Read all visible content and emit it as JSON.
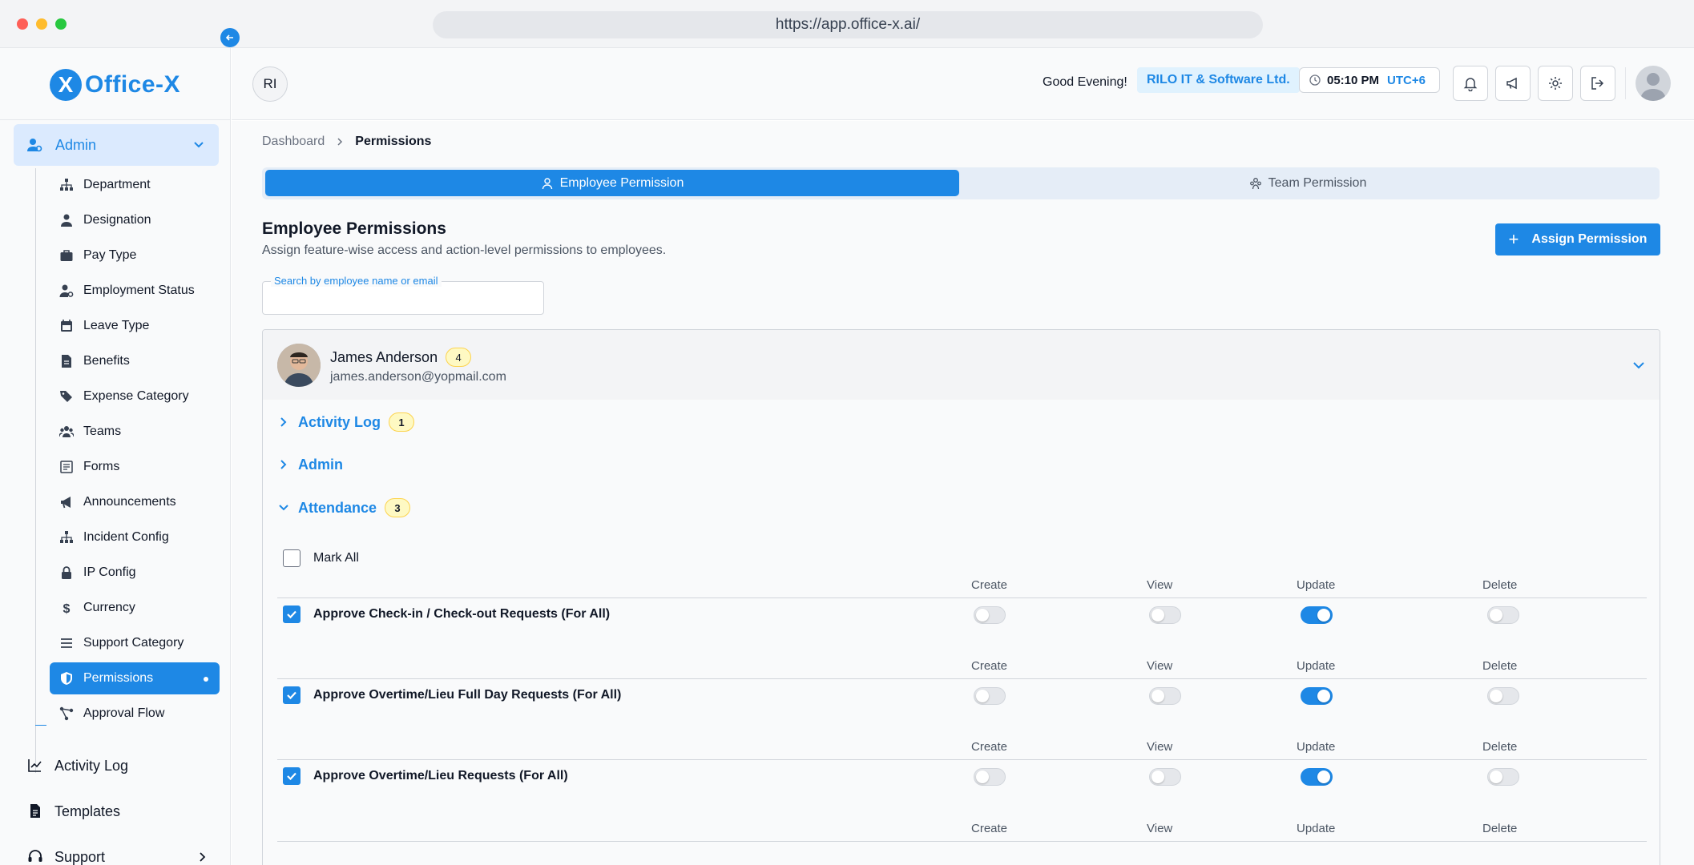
{
  "browser": {
    "url": "https://app.office-x.ai/"
  },
  "brand": {
    "logo_letter": "X",
    "name": "Office-X",
    "color": "#1e88e5"
  },
  "sidebar": {
    "admin_label": "Admin",
    "sub_items": [
      {
        "label": "Department",
        "icon": "sitemap-icon"
      },
      {
        "label": "Designation",
        "icon": "user-tie-icon"
      },
      {
        "label": "Pay Type",
        "icon": "briefcase-icon"
      },
      {
        "label": "Employment Status",
        "icon": "user-gear-icon"
      },
      {
        "label": "Leave Type",
        "icon": "calendar-icon"
      },
      {
        "label": "Benefits",
        "icon": "file-invoice-icon"
      },
      {
        "label": "Expense Category",
        "icon": "tags-icon"
      },
      {
        "label": "Teams",
        "icon": "users-icon"
      },
      {
        "label": "Forms",
        "icon": "form-icon"
      },
      {
        "label": "Announcements",
        "icon": "megaphone-icon"
      },
      {
        "label": "Incident Config",
        "icon": "sitemap-icon"
      },
      {
        "label": "IP Config",
        "icon": "lock-icon"
      },
      {
        "label": "Currency",
        "icon": "dollar-icon"
      },
      {
        "label": "Support Category",
        "icon": "list-icon"
      },
      {
        "label": "Permissions",
        "icon": "shield-icon",
        "active": true
      },
      {
        "label": "Approval Flow",
        "icon": "flow-icon"
      }
    ],
    "main_items": [
      {
        "label": "Activity Log",
        "icon": "chart-line-icon"
      },
      {
        "label": "Templates",
        "icon": "document-icon"
      },
      {
        "label": "Support",
        "icon": "headset-icon"
      }
    ]
  },
  "topbar": {
    "user_initials": "RI",
    "greeting": "Good Evening!",
    "company": "RILO IT & Software Ltd.",
    "time": "05:10 PM",
    "timezone": "UTC+6"
  },
  "breadcrumb": {
    "root": "Dashboard",
    "current": "Permissions"
  },
  "tabs": {
    "employee": "Employee Permission",
    "team": "Team Permission"
  },
  "page": {
    "title": "Employee Permissions",
    "subtitle": "Assign feature-wise access and action-level permissions to employees.",
    "assign_button": "Assign Permission",
    "search_label": "Search by employee name or email",
    "search_value": ""
  },
  "employee": {
    "name": "James Anderson",
    "count": "4",
    "email": "james.anderson@yopmail.com"
  },
  "modules": [
    {
      "name": "Activity Log",
      "count": "1"
    },
    {
      "name": "Admin",
      "count": ""
    },
    {
      "name": "Attendance",
      "count": "3"
    }
  ],
  "mark_all": "Mark All",
  "columns": {
    "create": "Create",
    "view": "View",
    "update": "Update",
    "delete": "Delete"
  },
  "permissions": [
    {
      "name": "Approve Check-in / Check-out Requests (For All)",
      "checked": true,
      "create": false,
      "view": false,
      "update": true,
      "delete": false
    },
    {
      "name": "Approve Overtime/Lieu Full Day Requests (For All)",
      "checked": true,
      "create": false,
      "view": false,
      "update": true,
      "delete": false
    },
    {
      "name": "Approve Overtime/Lieu Requests (For All)",
      "checked": true,
      "create": false,
      "view": false,
      "update": true,
      "delete": false
    }
  ]
}
